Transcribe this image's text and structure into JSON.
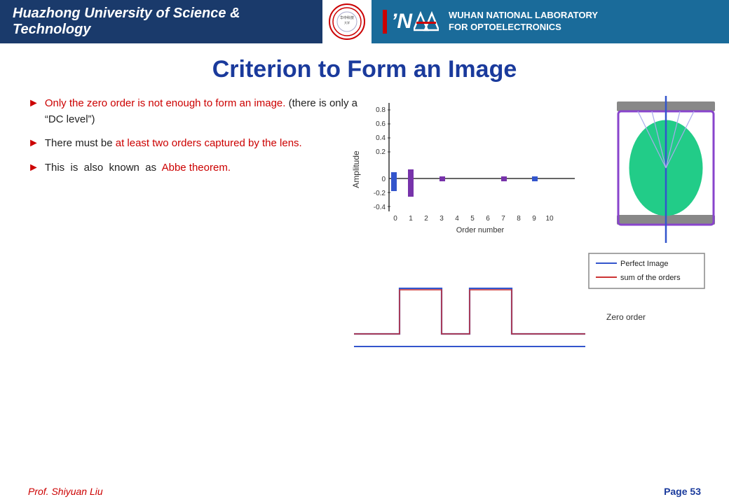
{
  "header": {
    "university_name": "Huazhong University of Science & Technology",
    "lab_line1": "WUHAN NATIONAL LABORATORY",
    "lab_line2": "FOR OPTOELECTRONICS"
  },
  "page": {
    "title": "Criterion to Form an Image",
    "footer_left": "Prof. Shiyuan  Liu",
    "footer_right": "Page 53"
  },
  "bullets": [
    {
      "id": 1,
      "prefix": "",
      "text_normal": "Only the zero order is not enough to form an image. (there is only a “DC level”)",
      "text_red": "Only the zero order is not enough",
      "has_red_start": true
    },
    {
      "id": 2,
      "text_normal": "There must be ",
      "text_red": "at least two orders captured by the lens.",
      "has_red_end": true
    },
    {
      "id": 3,
      "text_normal": "This  is  also  known  as ",
      "text_red": "Abbe theorem.",
      "has_red_end": true
    }
  ],
  "chart": {
    "title": "Bar chart",
    "x_label": "Order number",
    "y_label": "Amplitude",
    "y_axis": [
      "0.8",
      "0.6",
      "0.4",
      "0.2",
      "0",
      "-0.2",
      "-0.4"
    ],
    "x_axis": [
      "0",
      "1",
      "2",
      "3",
      "4",
      "5",
      "6",
      "7",
      "8",
      "9",
      "10"
    ]
  },
  "legend": {
    "perfect_image_label": "Perfect Image",
    "sum_orders_label": "sum of the orders"
  },
  "bottom_chart": {
    "zero_order_label": "Zero order"
  }
}
